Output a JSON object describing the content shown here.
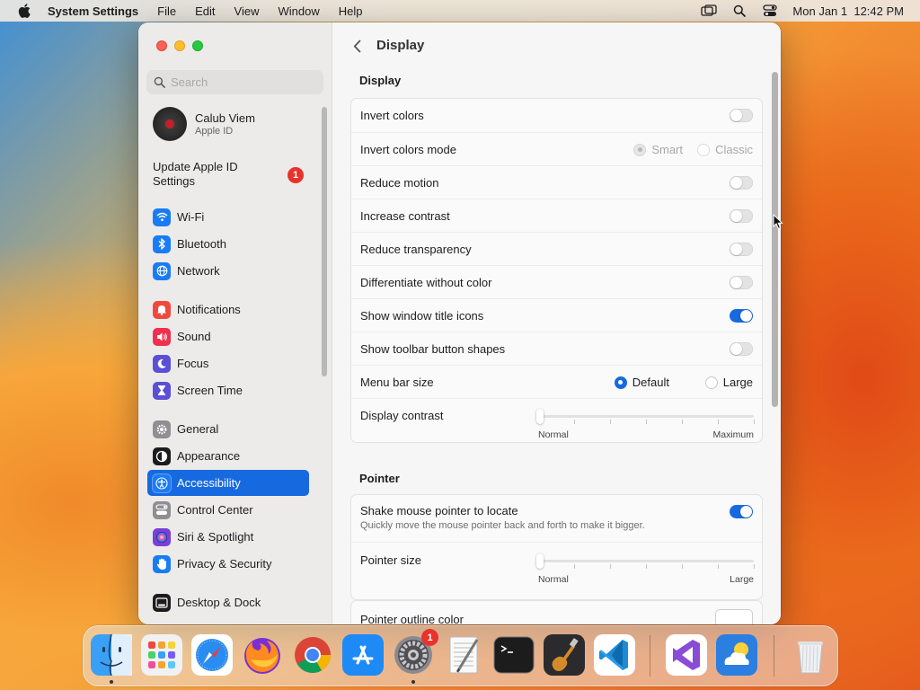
{
  "menubar": {
    "app_name": "System Settings",
    "menus": [
      "File",
      "Edit",
      "View",
      "Window",
      "Help"
    ],
    "clock": "Mon Jan 1  12:42 PM"
  },
  "sidebar": {
    "search_placeholder": "Search",
    "profile": {
      "name": "Calub Viem",
      "subtitle": "Apple ID"
    },
    "update": {
      "label": "Update Apple ID Settings",
      "badge": "1"
    },
    "items": [
      {
        "label": "Wi-Fi",
        "icon": "wifi-icon",
        "color": "#1a7cf5"
      },
      {
        "label": "Bluetooth",
        "icon": "bluetooth-icon",
        "color": "#1a7cf5"
      },
      {
        "label": "Network",
        "icon": "globe-icon",
        "color": "#1a7cf5"
      },
      {
        "label": "Notifications",
        "icon": "bell-icon",
        "color": "#f0483e"
      },
      {
        "label": "Sound",
        "icon": "speaker-icon",
        "color": "#f0304d"
      },
      {
        "label": "Focus",
        "icon": "moon-icon",
        "color": "#5b4fd6"
      },
      {
        "label": "Screen Time",
        "icon": "hourglass-icon",
        "color": "#5b4fd6"
      },
      {
        "label": "General",
        "icon": "gear-icon",
        "color": "#8e8e93"
      },
      {
        "label": "Appearance",
        "icon": "appearance-icon",
        "color": "#1c1c1e"
      },
      {
        "label": "Accessibility",
        "icon": "accessibility-icon",
        "color": "#1a7cf5",
        "selected": true
      },
      {
        "label": "Control Center",
        "icon": "control-center-icon",
        "color": "#8e8e93"
      },
      {
        "label": "Siri & Spotlight",
        "icon": "siri-icon",
        "color": "#7a3fd8"
      },
      {
        "label": "Privacy & Security",
        "icon": "hand-icon",
        "color": "#1a7cf5"
      },
      {
        "label": "Desktop & Dock",
        "icon": "dock-icon",
        "color": "#1c1c1e"
      }
    ]
  },
  "main": {
    "title": "Display",
    "display_section": {
      "title": "Display",
      "rows": [
        {
          "label": "Invert colors",
          "type": "toggle",
          "on": false
        },
        {
          "label": "Invert colors mode",
          "type": "radio",
          "options": [
            "Smart",
            "Classic"
          ],
          "selected": "Smart",
          "enabled": false
        },
        {
          "label": "Reduce motion",
          "type": "toggle",
          "on": false
        },
        {
          "label": "Increase contrast",
          "type": "toggle",
          "on": false
        },
        {
          "label": "Reduce transparency",
          "type": "toggle",
          "on": false
        },
        {
          "label": "Differentiate without color",
          "type": "toggle",
          "on": false
        },
        {
          "label": "Show window title icons",
          "type": "toggle",
          "on": true
        },
        {
          "label": "Show toolbar button shapes",
          "type": "toggle",
          "on": false
        },
        {
          "label": "Menu bar size",
          "type": "radio",
          "options": [
            "Default",
            "Large"
          ],
          "selected": "Default",
          "enabled": true
        },
        {
          "label": "Display contrast",
          "type": "slider",
          "min_label": "Normal",
          "max_label": "Maximum",
          "value": 0
        }
      ]
    },
    "pointer_section": {
      "title": "Pointer",
      "shake": {
        "label": "Shake mouse pointer to locate",
        "description": "Quickly move the mouse pointer back and forth to make it bigger.",
        "on": true
      },
      "pointer_size": {
        "label": "Pointer size",
        "min_label": "Normal",
        "max_label": "Large",
        "value": 0
      },
      "outline": {
        "label": "Pointer outline color"
      }
    }
  },
  "dock": {
    "apps": [
      {
        "name": "Finder",
        "icon": "finder-icon",
        "running": true
      },
      {
        "name": "Launchpad",
        "icon": "launchpad-icon"
      },
      {
        "name": "Safari",
        "icon": "safari-icon"
      },
      {
        "name": "Firefox",
        "icon": "firefox-icon"
      },
      {
        "name": "Chrome",
        "icon": "chrome-icon"
      },
      {
        "name": "App Store",
        "icon": "app-store-icon"
      },
      {
        "name": "System Settings",
        "icon": "system-settings-icon",
        "badge": "1",
        "running": true
      },
      {
        "name": "TextEdit",
        "icon": "textedit-icon"
      },
      {
        "name": "Terminal",
        "icon": "terminal-icon"
      },
      {
        "name": "GarageBand",
        "icon": "garageband-icon"
      },
      {
        "name": "VS Code",
        "icon": "vscode-icon"
      },
      {
        "name": "Visual Studio",
        "icon": "visual-studio-icon"
      },
      {
        "name": "Weather",
        "icon": "weather-icon"
      },
      {
        "name": "Trash",
        "icon": "trash-icon"
      }
    ]
  }
}
